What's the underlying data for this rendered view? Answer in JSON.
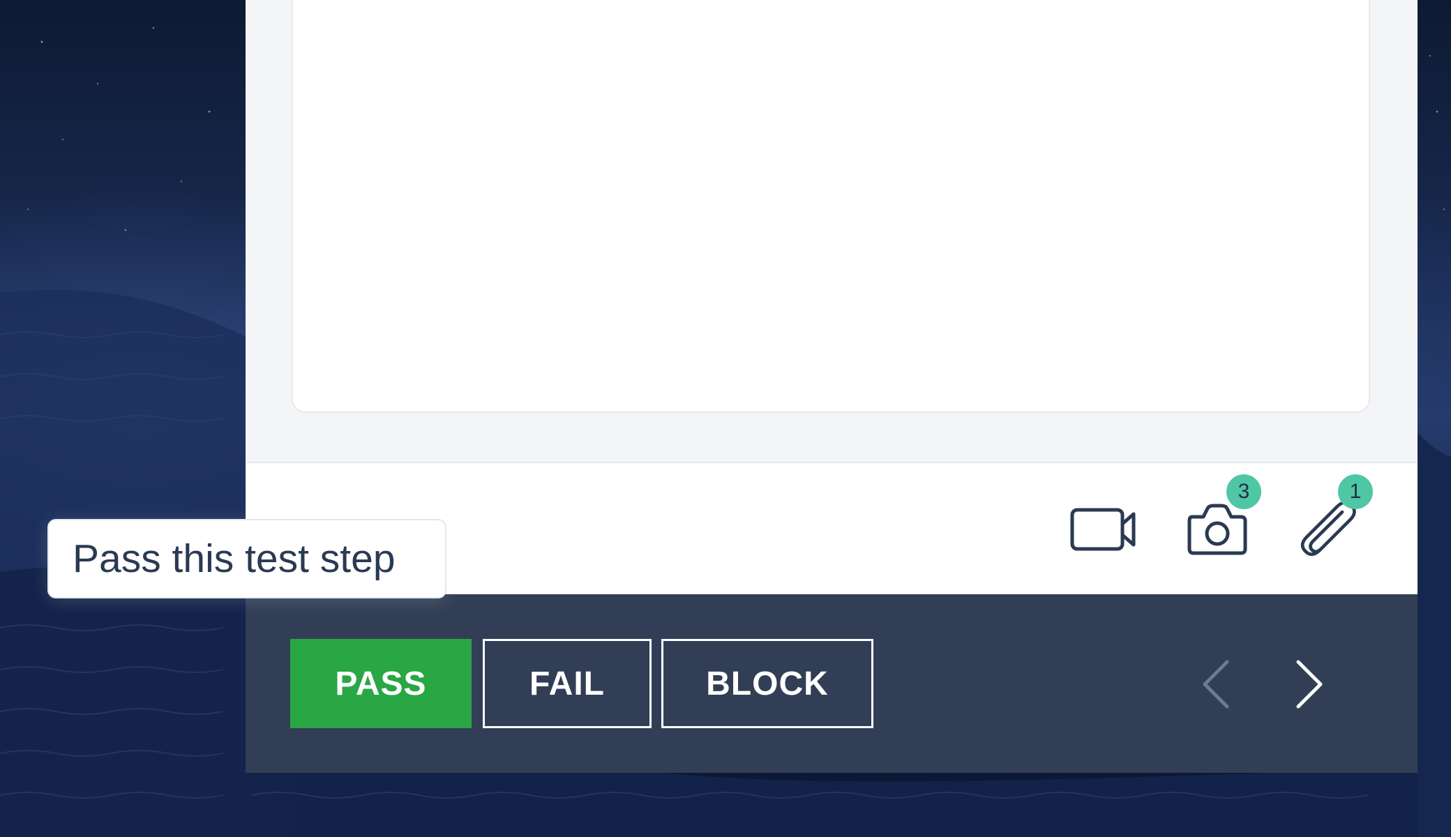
{
  "media_bar": {
    "video_icon": "video-camera-icon",
    "camera_icon": "camera-icon",
    "camera_count": "3",
    "attachment_icon": "paperclip-icon",
    "attachment_count": "1",
    "badge_color": "#4fc7a5"
  },
  "actions": {
    "pass_label": "PASS",
    "fail_label": "FAIL",
    "block_label": "BLOCK",
    "pass_color": "#29a745",
    "bar_color": "#313e55"
  },
  "navigation": {
    "prev_icon": "chevron-left-icon",
    "next_icon": "chevron-right-icon"
  },
  "tooltip": {
    "text": "Pass this test step"
  }
}
